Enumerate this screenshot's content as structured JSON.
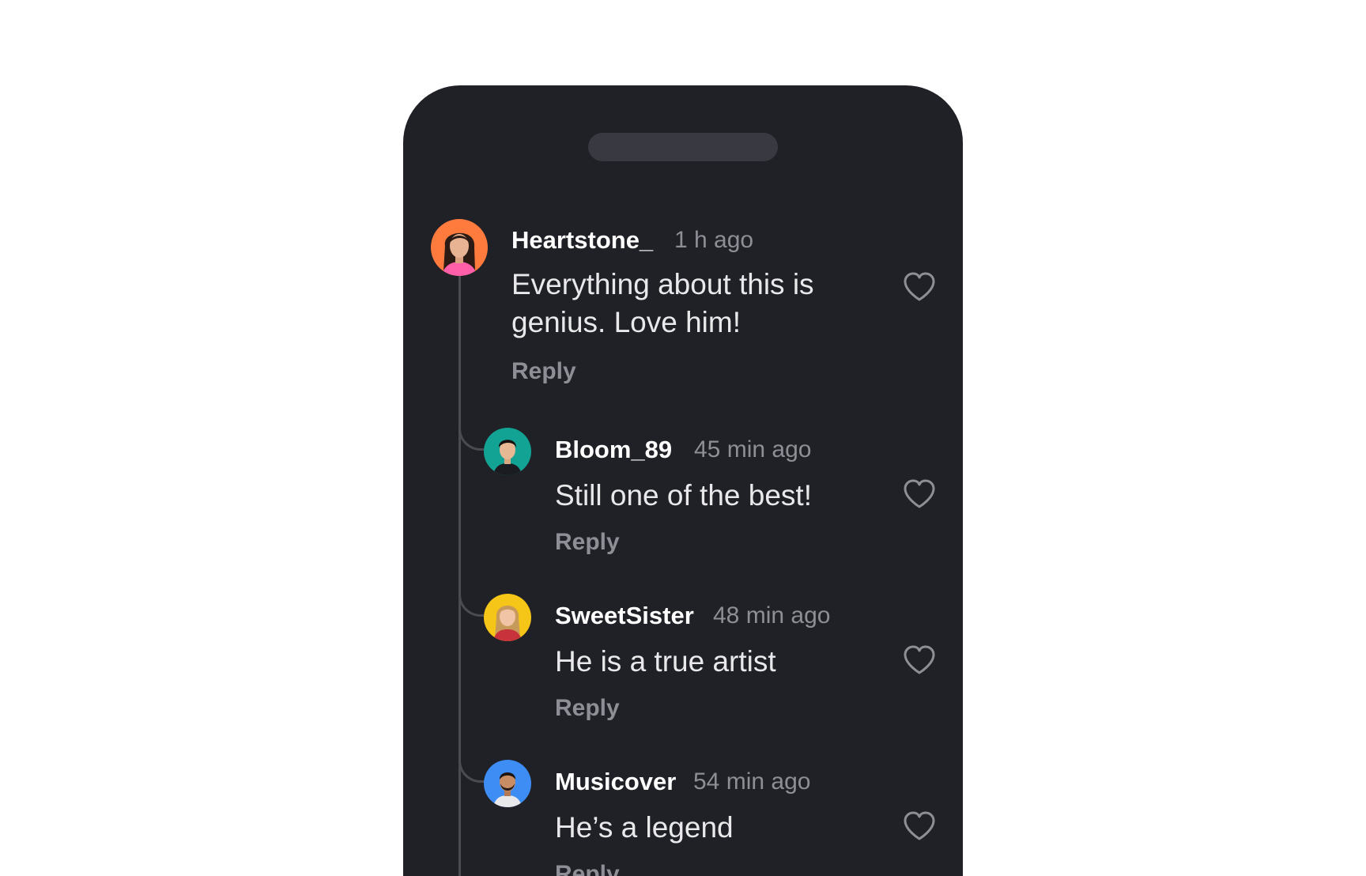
{
  "comments": [
    {
      "username": "Heartstone_",
      "time": "1 h ago",
      "text_lines": [
        "Everything about this is",
        "genius. Love him!"
      ],
      "reply_label": "Reply",
      "avatar_bg": "#ff7a3d"
    },
    {
      "username": "Bloom_89",
      "time": "45 min ago",
      "text_lines": [
        "Still one of the best!"
      ],
      "reply_label": "Reply",
      "avatar_bg": "#13a394"
    },
    {
      "username": "SweetSister",
      "time": "48 min ago",
      "text_lines": [
        "He is a true artist"
      ],
      "reply_label": "Reply",
      "avatar_bg": "#f5c518"
    },
    {
      "username": "Musicover",
      "time": "54 min ago",
      "text_lines": [
        "He’s a legend"
      ],
      "reply_label": "Reply",
      "avatar_bg": "#3d8df5"
    }
  ],
  "colors": {
    "panel_bg": "#202127",
    "thread_line": "#4a4b52",
    "muted_text": "#8e8f96"
  },
  "icons": {
    "like": "heart-outline-icon",
    "handle": "drag-handle"
  }
}
